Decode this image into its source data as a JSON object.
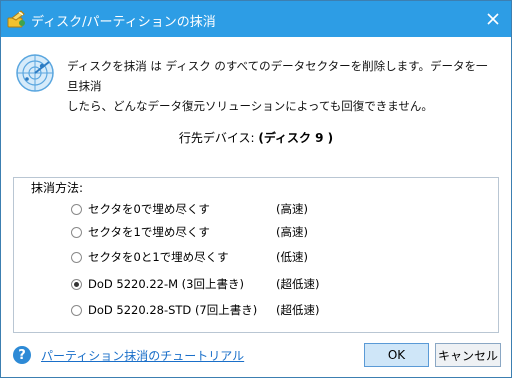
{
  "window": {
    "title": "ディスク/パーティションの抹消"
  },
  "description": {
    "line1": "ディスクを抹消 は ディスク のすべてのデータセクターを削除します。データを一旦抹消",
    "line2": "したら、どんなデータ復元ソリューションによっても回復できません。"
  },
  "target": {
    "label": "行先デバイス:",
    "value": "(ディスク 9 )"
  },
  "methods": {
    "legend": "抹消方法:",
    "options": [
      {
        "label": "セクタを0で埋め尽くす",
        "speed": "(高速)",
        "checked": false
      },
      {
        "label": "セクタを1で埋め尽くす",
        "speed": "(高速)",
        "checked": false
      },
      {
        "label": "セクタを0と1で埋め尽くす",
        "speed": "(低速)",
        "checked": false
      },
      {
        "label": "DoD 5220.22-M (3回上書き)",
        "speed": "(超低速)",
        "checked": true
      },
      {
        "label": "DoD 5220.28-STD (7回上書き)",
        "speed": "(超低速)",
        "checked": false
      }
    ]
  },
  "footer": {
    "help_icon_glyph": "?",
    "tutorial_link": "パーティション抹消のチュートリアル",
    "ok_label": "OK",
    "cancel_label": "キャンセル"
  },
  "icons": {
    "title": "wipe-icon",
    "info": "disk-radar-icon",
    "close": "close-icon",
    "help": "help-icon"
  },
  "colors": {
    "titlebar": "#2d9de5",
    "link": "#1a6fc9",
    "ok_button": "#cfe6f8"
  }
}
